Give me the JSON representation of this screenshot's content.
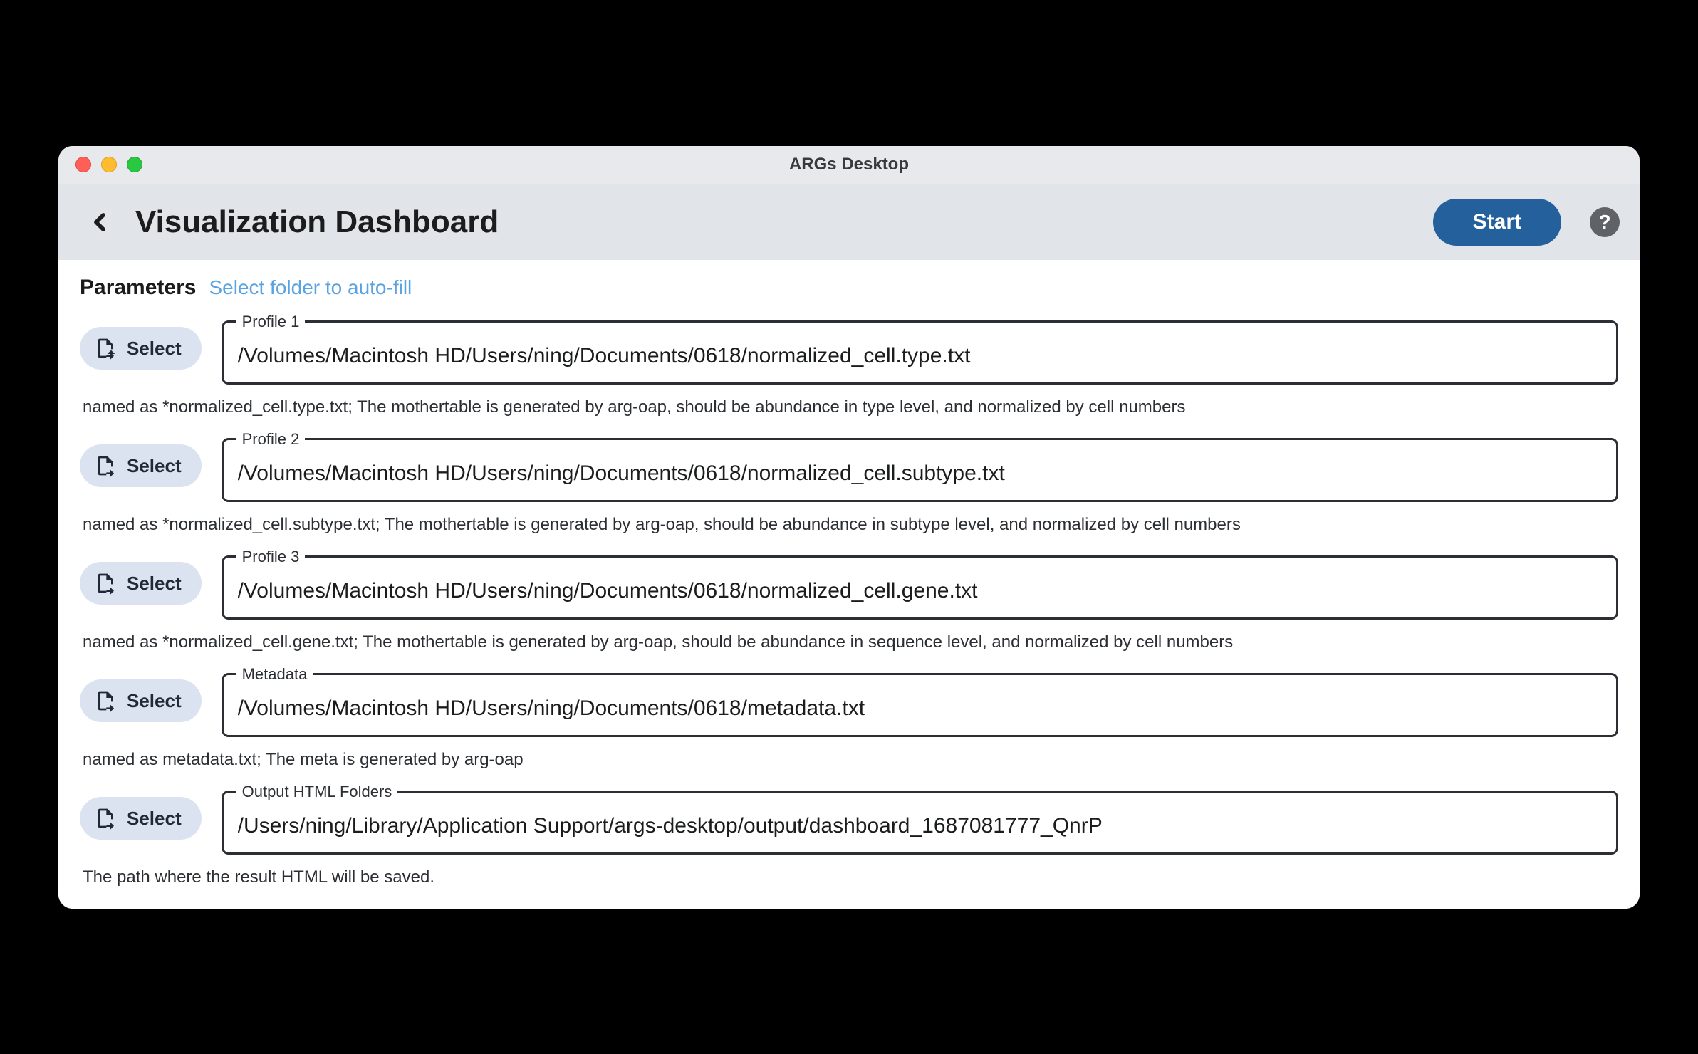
{
  "window": {
    "title": "ARGs Desktop"
  },
  "header": {
    "page_title": "Visualization Dashboard",
    "start_label": "Start"
  },
  "params": {
    "label": "Parameters",
    "autofill_label": "Select folder to auto-fill"
  },
  "select_label": "Select",
  "fields": {
    "profile1": {
      "legend": "Profile 1",
      "value": "/Volumes/Macintosh HD/Users/ning/Documents/0618/normalized_cell.type.txt",
      "helper": "named as *normalized_cell.type.txt; The mothertable is generated by arg-oap, should be abundance in type level, and normalized by cell numbers"
    },
    "profile2": {
      "legend": "Profile 2",
      "value": "/Volumes/Macintosh HD/Users/ning/Documents/0618/normalized_cell.subtype.txt",
      "helper": "named as *normalized_cell.subtype.txt; The mothertable is generated by arg-oap, should be abundance in subtype level, and normalized by cell numbers"
    },
    "profile3": {
      "legend": "Profile 3",
      "value": "/Volumes/Macintosh HD/Users/ning/Documents/0618/normalized_cell.gene.txt",
      "helper": "named as *normalized_cell.gene.txt; The mothertable is generated by arg-oap, should be abundance in sequence level, and normalized by cell numbers"
    },
    "metadata": {
      "legend": "Metadata",
      "value": "/Volumes/Macintosh HD/Users/ning/Documents/0618/metadata.txt",
      "helper": "named as metadata.txt; The meta is generated by arg-oap"
    },
    "output": {
      "legend": "Output HTML Folders",
      "value": "/Users/ning/Library/Application Support/args-desktop/output/dashboard_1687081777_QnrP",
      "helper": "The path where the result HTML will be saved."
    }
  }
}
